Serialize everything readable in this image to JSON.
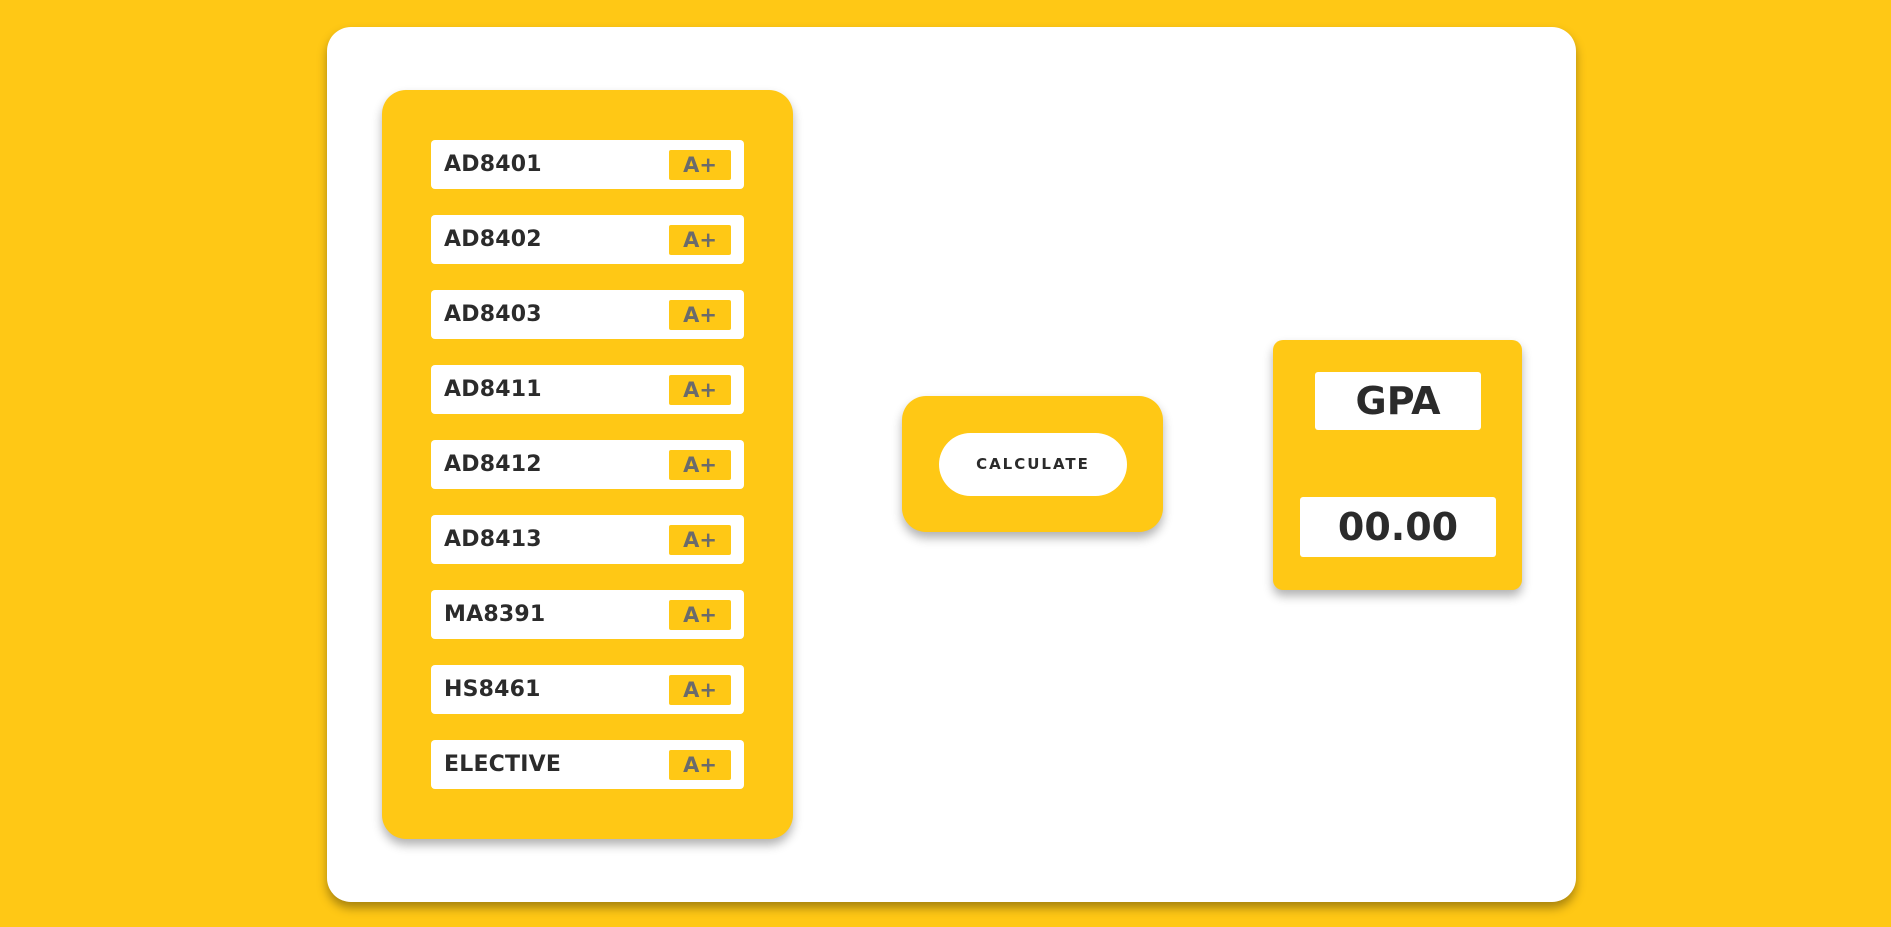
{
  "subjects": [
    {
      "code": "AD8401",
      "grade": "A+"
    },
    {
      "code": "AD8402",
      "grade": "A+"
    },
    {
      "code": "AD8403",
      "grade": "A+"
    },
    {
      "code": "AD8411",
      "grade": "A+"
    },
    {
      "code": "AD8412",
      "grade": "A+"
    },
    {
      "code": "AD8413",
      "grade": "A+"
    },
    {
      "code": "MA8391",
      "grade": "A+"
    },
    {
      "code": "HS8461",
      "grade": "A+"
    },
    {
      "code": "ELECTIVE",
      "grade": "A+"
    }
  ],
  "calculate": {
    "label": "CALCULATE"
  },
  "result": {
    "title": "GPA",
    "value": "00.00"
  },
  "colors": {
    "accent": "#FFC815",
    "card": "#FFFFFF",
    "text": "#2B2B2B",
    "grade_text": "#6B6B6B"
  }
}
